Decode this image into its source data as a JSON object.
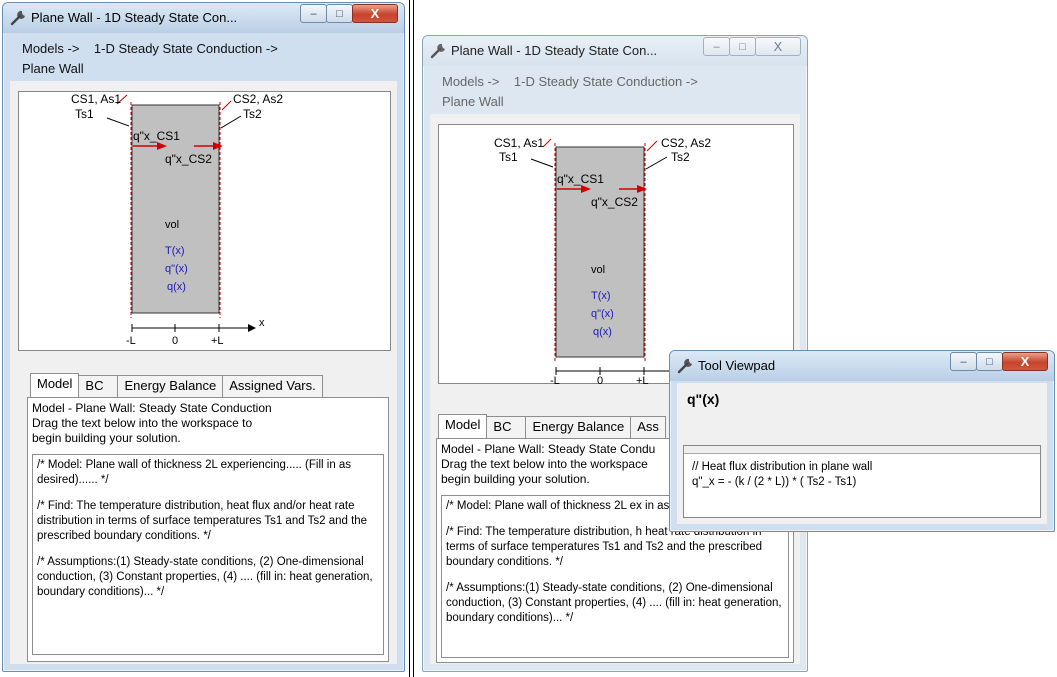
{
  "left_window": {
    "title": "Plane Wall - 1D Steady State Con...",
    "breadcrumb_line1": "Models ->    1-D Steady State Conduction ->",
    "breadcrumb_line2": "Plane Wall",
    "close_glyph": "X",
    "tabs": [
      "Model",
      "BC",
      "Energy Balance",
      "Assigned Vars."
    ],
    "pane_title": "Model - Plane Wall: Steady State Conduction",
    "pane_line2": "Drag the text below into the workspace to",
    "pane_line3": "begin building your solution.",
    "text_p1": "/* Model: Plane wall of thickness 2L experiencing..... (Fill in as desired)...... */",
    "text_p2": "/* Find: The temperature distribution, heat flux and/or heat rate distribution in terms of surface temperatures Ts1 and Ts2 and the prescribed boundary conditions. */",
    "text_p3": "/* Assumptions:(1) Steady-state conditions, (2) One-dimensional conduction, (3) Constant properties, (4) .... (fill in: heat generation, boundary conditions)... */"
  },
  "right_window": {
    "title": "Plane Wall - 1D Steady State Con...",
    "breadcrumb_line1": "Models ->    1-D Steady State Conduction ->",
    "breadcrumb_line2": "Plane Wall",
    "close_glyph": "X",
    "tabs": [
      "Model",
      "BC",
      "Energy Balance",
      "Ass"
    ],
    "pane_title": "Model - Plane Wall: Steady State Condu",
    "pane_line2": "Drag the text below into the workspace",
    "pane_line3": "begin building your solution.",
    "text_p1": "/* Model: Plane wall of thickness 2L ex in as desired)...... */",
    "text_p2": "/* Find: The temperature distribution, h heat rate distribution in terms of surface temperatures Ts1 and Ts2 and the prescribed boundary conditions. */",
    "text_p3": "/* Assumptions:(1) Steady-state conditions, (2) One-dimensional conduction, (3) Constant properties, (4) .... (fill in: heat generation, boundary conditions)... */"
  },
  "diagram": {
    "cs1_label": "CS1, As1",
    "ts1_label": "Ts1",
    "cs2_label": "CS2, As2",
    "ts2_label": "Ts2",
    "qx_cs1": "q\"x_CS1",
    "qx_cs2": "q\"x_CS2",
    "vol": "vol",
    "t_of_x": "T(x)",
    "qpp_of_x": "q\"(x)",
    "q_of_x": "q(x)",
    "axis_x": "x",
    "axis_neg_l": "-L",
    "axis_zero": "0",
    "axis_pos_l": "+L",
    "wall_color": "#c0c0c0",
    "arrow_color": "#d40000",
    "var_color": "#1a1ab8"
  },
  "viewpad": {
    "title": "Tool Viewpad",
    "heading": "q\"(x)",
    "close_glyph": "X",
    "comment": "// Heat flux distribution in plane wall",
    "equation": "q\"_x = - (k / (2 * L)) * ( Ts2 - Ts1)"
  }
}
